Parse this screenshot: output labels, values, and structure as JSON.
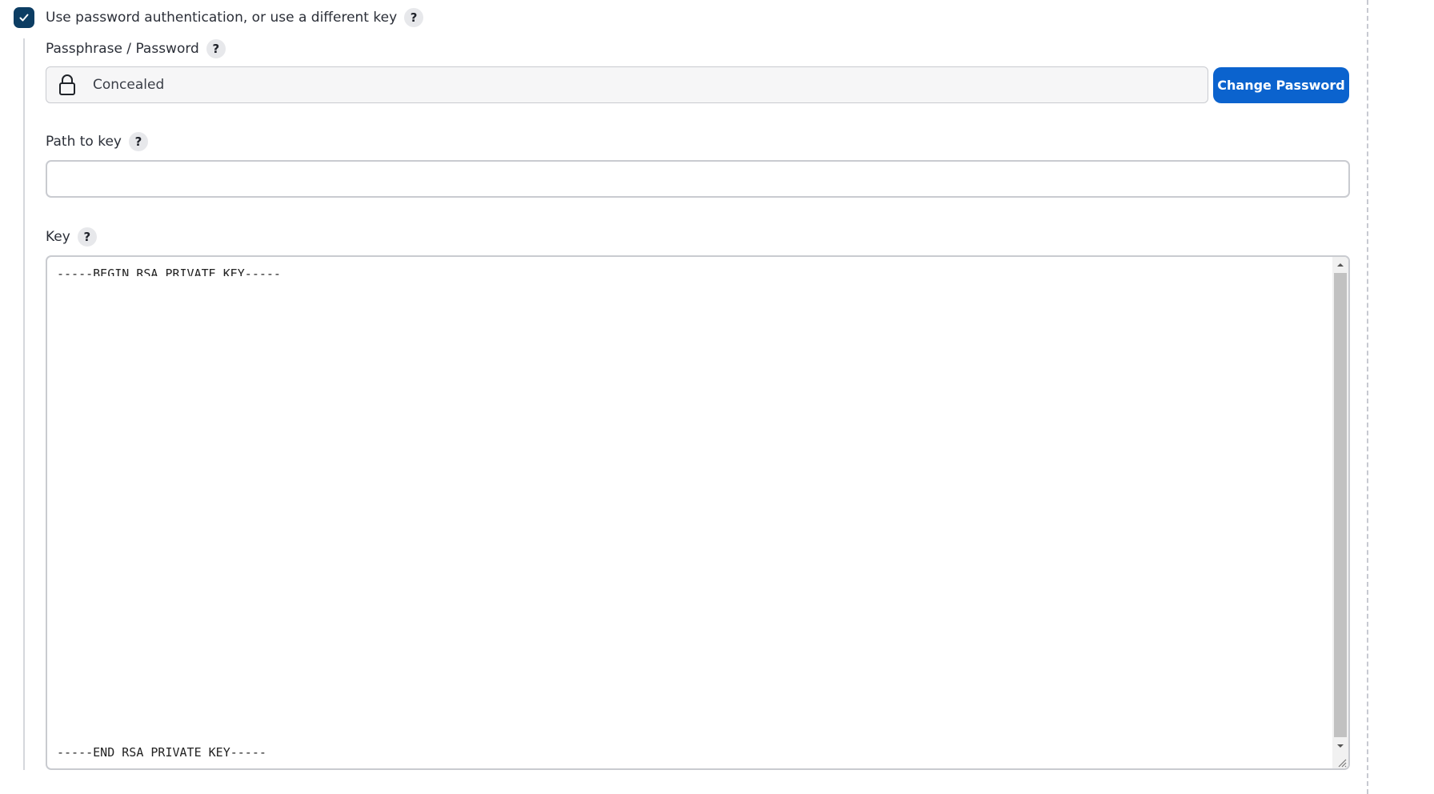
{
  "option": {
    "checked": true,
    "label": "Use password authentication, or use a different key",
    "help": "?"
  },
  "passphrase": {
    "label": "Passphrase / Password",
    "help": "?",
    "value": "Concealed",
    "change_button": "Change Password"
  },
  "path_to_key": {
    "label": "Path to key",
    "help": "?",
    "value": ""
  },
  "key": {
    "label": "Key",
    "help": "?",
    "first_line": "-----BEGIN RSA PRIVATE KEY-----",
    "last_line": "-----END RSA PRIVATE KEY-----"
  },
  "colors": {
    "checkbox": "#0c3d63",
    "primary_button": "#0b63ce",
    "help_badge": "#e7e8eb",
    "border": "#c9cbd0"
  },
  "icons": {
    "checkbox": "checkmark-icon",
    "lock": "lock-icon",
    "scroll_up": "chevron-up-icon",
    "scroll_down": "chevron-down-icon",
    "resize": "resize-grip-icon"
  }
}
